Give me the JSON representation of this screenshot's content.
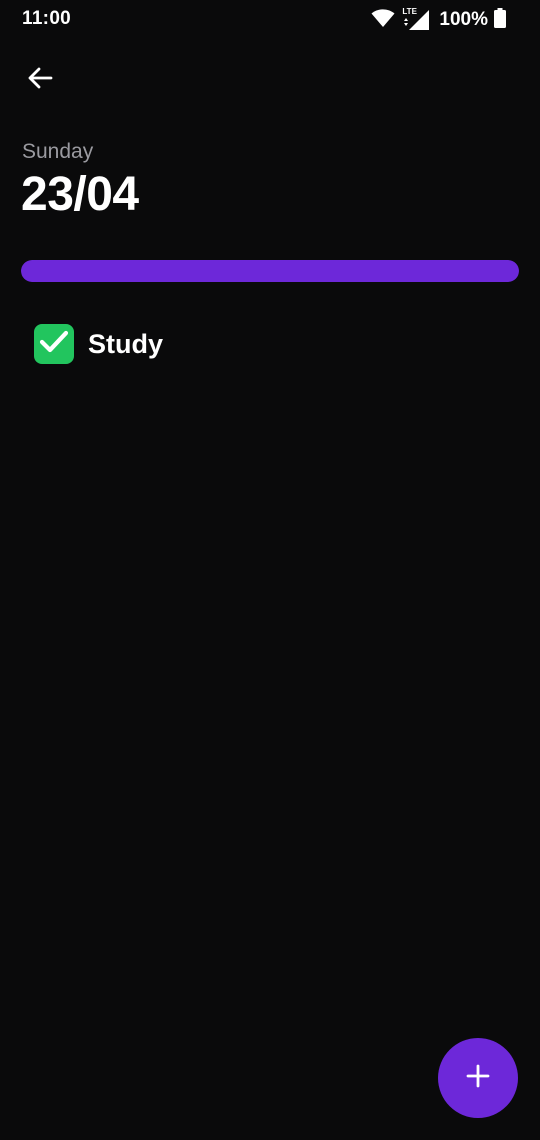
{
  "status_bar": {
    "time": "11:00",
    "battery": "100%",
    "network_label": "LTE",
    "icons": [
      "wifi-icon",
      "lte-signal-icon",
      "battery-icon"
    ]
  },
  "header": {
    "back_icon": "arrow-left-icon"
  },
  "day": {
    "weekday": "Sunday",
    "date": "23/04"
  },
  "progress": {
    "value_percent": 100,
    "color": "#6d28d9"
  },
  "tasks": [
    {
      "label": "Study",
      "done": true
    }
  ],
  "fab": {
    "icon": "plus-icon",
    "color": "#6d28d9"
  },
  "colors": {
    "background": "#0a0a0b",
    "accent": "#6d28d9",
    "check": "#22c55e",
    "muted_text": "#9a9aa0"
  }
}
